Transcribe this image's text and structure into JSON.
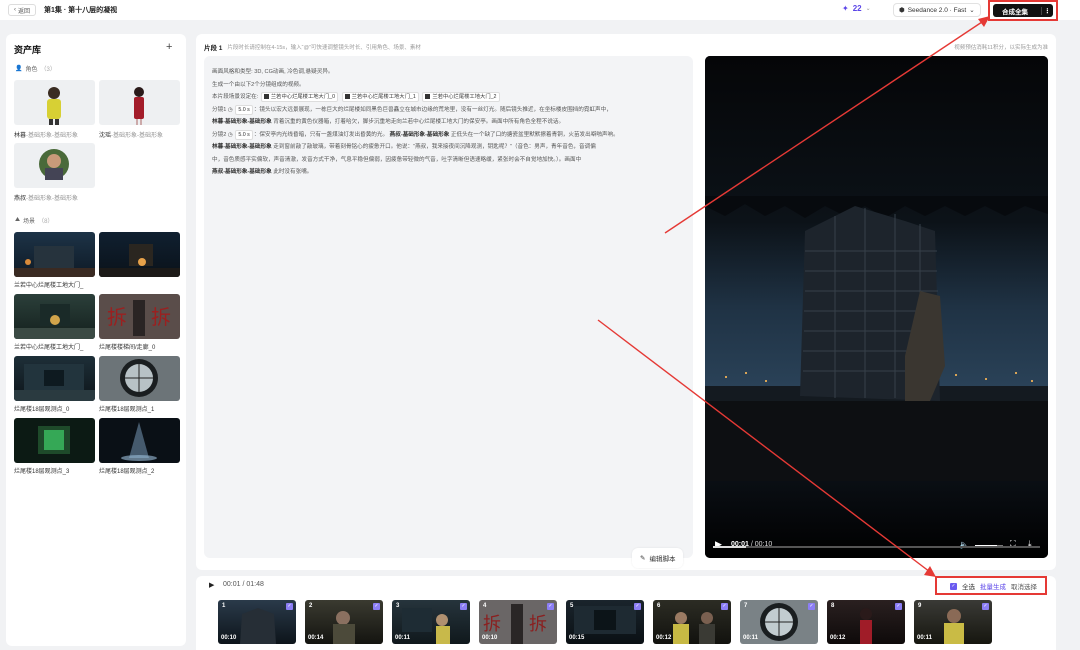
{
  "header": {
    "back_label": "返回",
    "episode_title": "第1集 · 第十八层的凝视",
    "credits": "22",
    "model": "Seedance 2.0 · Fast",
    "compose_label": "合成全集"
  },
  "assets": {
    "title": "资产库",
    "roles_label": "角色",
    "roles_count": "（3）",
    "roles": [
      {
        "name": "林暮",
        "sub": "-基础形象-基础形象"
      },
      {
        "name": "沈瑶",
        "sub": "-基础形象-基础形象"
      },
      {
        "name": "燕叔",
        "sub": "-基础形象-基础形象"
      }
    ],
    "scenes_label": "场景",
    "scenes_count": "（8）",
    "scenes": [
      "兰若中心烂尾楼工地大门_",
      "兰若中心烂尾楼工地大门_",
      "兰若中心烂尾楼工地大门_",
      "烂尾楼楼梯间/走廊_0",
      "烂尾楼18层观测点_0",
      "烂尾楼18层观测点_1",
      "烂尾楼18层观测点_3",
      "烂尾楼18层观测点_2"
    ]
  },
  "segment": {
    "label": "片段 1",
    "hint": "片段时长请控制在4-15s，输入“@”可快速调整镜头时长、引用角色、场景、素材",
    "right_note": "视频预估消耗11积分，以实际生成为准",
    "script": {
      "line1": "画面风格和类型: 3D, CG动画, 冷色调,悬疑灵异。",
      "line2": "生成一个由以下2个分镜组成的视频。",
      "line3_prefix": "本片段场景设定在:",
      "scene_chips": [
        "兰若中心烂尾楼工地大门_0",
        "兰若中心烂尾楼工地大门_1",
        "兰若中心烂尾楼工地大门_2"
      ],
      "shot1_prefix": "分镜1",
      "shot1_dur": "5.0 s",
      "shot1_text": "：镜头以宏大远景展现，一栋巨大的烂尾楼如同黑色巨兽矗立在城市边缘的荒地里，没有一丝灯光。随后镜头推近，在坐标楼皮围挡的霓虹声中，",
      "shot1_line2_role": "林暮-基础形象-基础形象",
      "shot1_line2_text": "背着沉重的黄色仪器箱，打着哈欠，脚步沉重地走向兰若中心烂尾楼工地大门的保安亭。画面中所有角色全程不说话。",
      "shot2_prefix": "分镜2",
      "shot2_dur": "5.0 s",
      "shot2_text": "：保安亭内光线昏暗，只有一盏煤油灯发出昏黄的光。",
      "shot2_role": "燕叔-基础形象-基础形象",
      "shot2_text_b": "正低头在一个缺了口的搪瓷盆里默默擦着青铜，火苗发出噼啪声响。",
      "shot2_line2_role": "林暮-基础形象-基础形象",
      "shot2_line2_text": "走到窗前敲了敲玻璃，带着刻骨铭心的疲惫开口。他说：“燕叔，我来接夜间沉降观测，钥匙呢？”（音色：男声，青年音色，音调偏",
      "shot2_line3": "中，音色质感平实偏软，声音清澈，发音方式干净，气息平稳但偏弱，因疲惫带轻微的气音，吐字清晰但语速略缓，紧张时会不自觉地加快。）。画面中",
      "shot2_line4_role": "燕叔-基础形象-基础形象",
      "shot2_line4_text": "此时没有张嘴。"
    },
    "edit_label": "编辑脚本",
    "player": {
      "current": "00:01",
      "total": "00:10",
      "progress": 0.1
    }
  },
  "timeline": {
    "time": "00:01 / 01:48",
    "select_all": "全选",
    "batch_generate": "批量生成",
    "cancel_select": "取消选择",
    "clips": [
      {
        "num": "1",
        "dur": "00:10"
      },
      {
        "num": "2",
        "dur": "00:14"
      },
      {
        "num": "3",
        "dur": "00:11"
      },
      {
        "num": "4",
        "dur": "00:10"
      },
      {
        "num": "5",
        "dur": "00:15"
      },
      {
        "num": "6",
        "dur": "00:12"
      },
      {
        "num": "7",
        "dur": "00:11"
      },
      {
        "num": "8",
        "dur": "00:12"
      },
      {
        "num": "9",
        "dur": "00:11"
      }
    ]
  },
  "colors": {
    "accent": "#5b45e8",
    "annotation_red": "#e53935"
  }
}
